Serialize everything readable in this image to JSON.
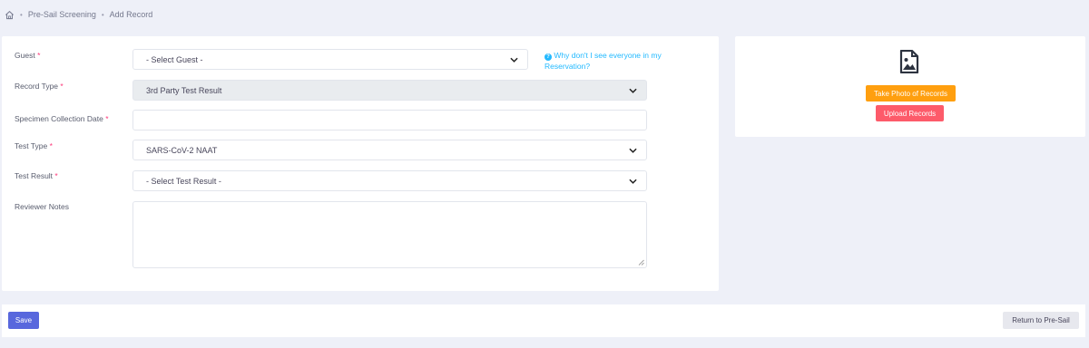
{
  "breadcrumb": {
    "items": [
      "Pre-Sail Screening",
      "Add Record"
    ],
    "separator": "•"
  },
  "form": {
    "guest": {
      "label": "Guest",
      "required": "*",
      "value": "- Select Guest -"
    },
    "help_link": "Why don't I see everyone in my Reservation?",
    "record_type": {
      "label": "Record Type",
      "required": "*",
      "value": "3rd Party Test Result"
    },
    "specimen_date": {
      "label": "Specimen Collection Date",
      "required": "*",
      "value": ""
    },
    "test_type": {
      "label": "Test Type",
      "required": "*",
      "value": "SARS-CoV-2 NAAT"
    },
    "test_result": {
      "label": "Test Result",
      "required": "*",
      "value": "- Select Test Result -"
    },
    "reviewer_notes": {
      "label": "Reviewer Notes",
      "value": ""
    }
  },
  "records": {
    "icon": "image-file-icon",
    "take_photo_label": "Take Photo of Records",
    "upload_label": "Upload Records"
  },
  "footer": {
    "save_label": "Save",
    "return_label": "Return to Pre-Sail"
  },
  "colors": {
    "accent": "#5867dd",
    "warning": "#ff9f0f",
    "danger": "#fd5b6a",
    "link": "#22b9ff",
    "required": "#fd397a"
  }
}
